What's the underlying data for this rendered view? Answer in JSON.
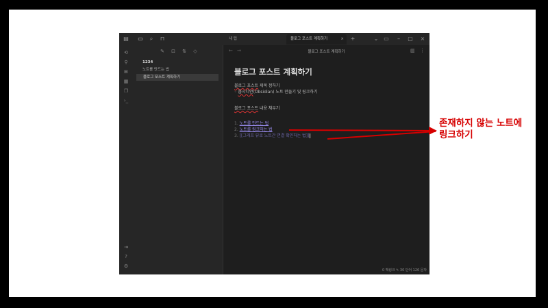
{
  "window": {
    "tabs": [
      {
        "label": "새 탭",
        "active": false
      },
      {
        "label": "블로그 포스트 계획하기",
        "active": true
      }
    ],
    "tab_close": "×",
    "new_tab": "+",
    "window_buttons": [
      "⌄",
      "▭",
      "–",
      "▢",
      "×"
    ]
  },
  "ribbon": {
    "icons": [
      "file-switcher-icon",
      "graph-icon",
      "canvas-icon",
      "calendar-icon",
      "templates-icon",
      "terminal-icon"
    ],
    "bottom_icons": [
      "vault-switch-icon",
      "help-icon",
      "settings-icon"
    ]
  },
  "explorer": {
    "toolbar": [
      "new-note-icon",
      "new-folder-icon",
      "sort-icon",
      "collapse-icon"
    ],
    "folder": "1234",
    "files": [
      "노트를 만드는 법",
      "블로그 포스트 계획하기"
    ]
  },
  "editor": {
    "breadcrumb": "블로그 포스트 계획하기",
    "title": "블로그 포스트 계획하기",
    "line1_a": "블로그 포스트",
    "line1_b": " 제목 정하기",
    "bullet": "◦",
    "line2_a": "옵시디언",
    "line2_b": "(Obsidian) 노트 만들기 및 링크하기",
    "line3_a": "블로그 포스트",
    "line3_b": " 내용 채우기",
    "list": [
      {
        "num": "1.",
        "text": "노트를 만드는 법"
      },
      {
        "num": "2.",
        "text": "노트를 링크하는 법"
      },
      {
        "num": "3.",
        "text": "[[그래프 뷰로 노트간 연결 확인하는 법]]"
      }
    ],
    "status": "0 백링크   ✎   30 단어   126 문자"
  },
  "annotation": {
    "line1": "존재하지 않는 노트에",
    "line2": "링크하기",
    "color": "#d60000"
  }
}
